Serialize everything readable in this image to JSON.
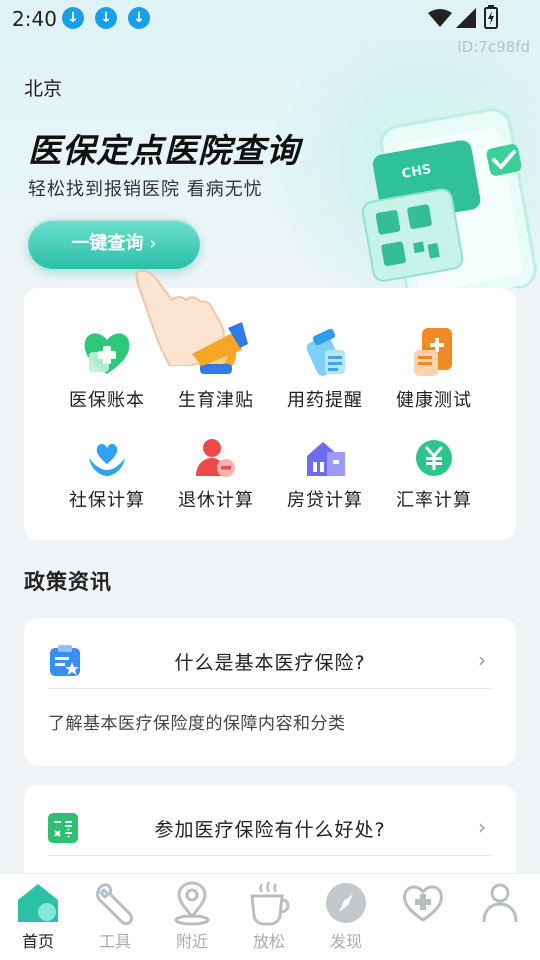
{
  "status_bar": {
    "time": "2:40",
    "icons": [
      "download-icon",
      "download-icon",
      "download-icon",
      "wifi-icon",
      "signal-icon",
      "battery-icon"
    ]
  },
  "device_id": "ID:7c98fd",
  "hero": {
    "city": "北京",
    "title": "医保定点医院查询",
    "subtitle": "轻松找到报销医院 看病无忧",
    "button_label": "一键查询",
    "button_chevron": "›",
    "phone_badge": "CHS"
  },
  "features": [
    {
      "label": "医保账本",
      "icon": "medical-ledger-icon",
      "color": "#2cc97a"
    },
    {
      "label": "生育津贴",
      "icon": "maternity-allowance-icon",
      "color": "#f5a623"
    },
    {
      "label": "用药提醒",
      "icon": "medication-reminder-icon",
      "color": "#3aa9f0"
    },
    {
      "label": "健康测试",
      "icon": "health-test-icon",
      "color": "#f08a24"
    },
    {
      "label": "社保计算",
      "icon": "social-security-calc-icon",
      "color": "#2fa3f0"
    },
    {
      "label": "退休计算",
      "icon": "retirement-calc-icon",
      "color": "#ef4a4a"
    },
    {
      "label": "房贷计算",
      "icon": "mortgage-calc-icon",
      "color": "#6d6cf0"
    },
    {
      "label": "汇率计算",
      "icon": "exchange-rate-icon",
      "color": "#2fc48a"
    }
  ],
  "policy": {
    "section_title": "政策资讯",
    "articles": [
      {
        "title": "什么是基本医疗保险?",
        "description": "了解基本医疗保险度的保障内容和分类",
        "icon": "clipboard-icon",
        "color": "#3a8ef0"
      },
      {
        "title": "参加医疗保险有什么好处?",
        "description": "",
        "icon": "calculator-icon",
        "color": "#2fbf71"
      }
    ]
  },
  "bottom_nav": {
    "items": [
      {
        "label": "首页",
        "icon": "home-icon",
        "active": true
      },
      {
        "label": "工具",
        "icon": "wrench-icon",
        "active": false
      },
      {
        "label": "附近",
        "icon": "location-pin-icon",
        "active": false
      },
      {
        "label": "放松",
        "icon": "coffee-cup-icon",
        "active": false
      },
      {
        "label": "发现",
        "icon": "compass-icon",
        "active": false
      },
      {
        "label": "",
        "icon": "heart-plus-icon",
        "active": false
      },
      {
        "label": "",
        "icon": "profile-icon",
        "active": false
      }
    ]
  },
  "colors": {
    "accent": "#2bbfa8",
    "background": "#f1f4f6",
    "card": "#ffffff"
  }
}
